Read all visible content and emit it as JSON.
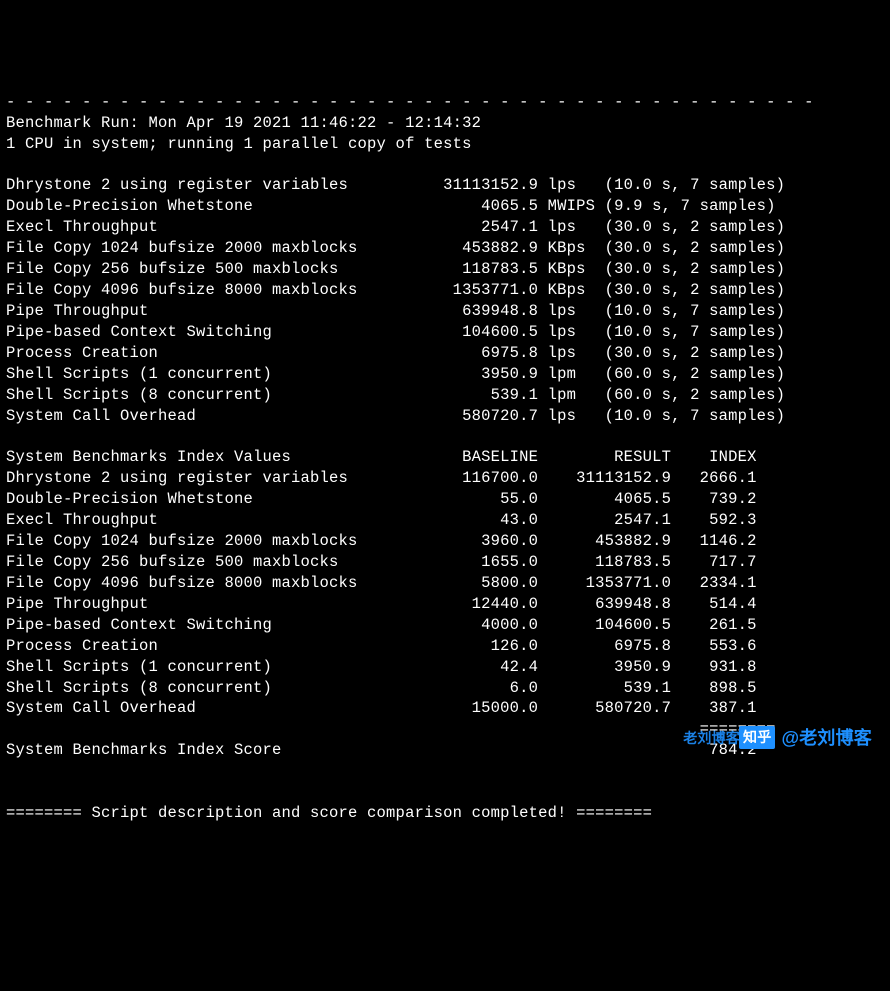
{
  "divider": "- - - - - - - - - - - - - - - - - - - - - - - - - - - - - - - - - - - - - - - - - - -",
  "header": {
    "run_line": "Benchmark Run: Mon Apr 19 2021 11:46:22 - 12:14:32",
    "cpu_line": "1 CPU in system; running 1 parallel copy of tests"
  },
  "results": [
    {
      "name": "Dhrystone 2 using register variables",
      "value": "31113152.9",
      "unit": "lps",
      "note": "(10.0 s, 7 samples)"
    },
    {
      "name": "Double-Precision Whetstone",
      "value": "4065.5",
      "unit": "MWIPS",
      "note": "(9.9 s, 7 samples)"
    },
    {
      "name": "Execl Throughput",
      "value": "2547.1",
      "unit": "lps",
      "note": "(30.0 s, 2 samples)"
    },
    {
      "name": "File Copy 1024 bufsize 2000 maxblocks",
      "value": "453882.9",
      "unit": "KBps",
      "note": "(30.0 s, 2 samples)"
    },
    {
      "name": "File Copy 256 bufsize 500 maxblocks",
      "value": "118783.5",
      "unit": "KBps",
      "note": "(30.0 s, 2 samples)"
    },
    {
      "name": "File Copy 4096 bufsize 8000 maxblocks",
      "value": "1353771.0",
      "unit": "KBps",
      "note": "(30.0 s, 2 samples)"
    },
    {
      "name": "Pipe Throughput",
      "value": "639948.8",
      "unit": "lps",
      "note": "(10.0 s, 7 samples)"
    },
    {
      "name": "Pipe-based Context Switching",
      "value": "104600.5",
      "unit": "lps",
      "note": "(10.0 s, 7 samples)"
    },
    {
      "name": "Process Creation",
      "value": "6975.8",
      "unit": "lps",
      "note": "(30.0 s, 2 samples)"
    },
    {
      "name": "Shell Scripts (1 concurrent)",
      "value": "3950.9",
      "unit": "lpm",
      "note": "(60.0 s, 2 samples)"
    },
    {
      "name": "Shell Scripts (8 concurrent)",
      "value": "539.1",
      "unit": "lpm",
      "note": "(60.0 s, 2 samples)"
    },
    {
      "name": "System Call Overhead",
      "value": "580720.7",
      "unit": "lps",
      "note": "(10.0 s, 7 samples)"
    }
  ],
  "index_header": {
    "title": "System Benchmarks Index Values",
    "col1": "BASELINE",
    "col2": "RESULT",
    "col3": "INDEX"
  },
  "index_rows": [
    {
      "name": "Dhrystone 2 using register variables",
      "baseline": "116700.0",
      "result": "31113152.9",
      "index": "2666.1"
    },
    {
      "name": "Double-Precision Whetstone",
      "baseline": "55.0",
      "result": "4065.5",
      "index": "739.2"
    },
    {
      "name": "Execl Throughput",
      "baseline": "43.0",
      "result": "2547.1",
      "index": "592.3"
    },
    {
      "name": "File Copy 1024 bufsize 2000 maxblocks",
      "baseline": "3960.0",
      "result": "453882.9",
      "index": "1146.2"
    },
    {
      "name": "File Copy 256 bufsize 500 maxblocks",
      "baseline": "1655.0",
      "result": "118783.5",
      "index": "717.7"
    },
    {
      "name": "File Copy 4096 bufsize 8000 maxblocks",
      "baseline": "5800.0",
      "result": "1353771.0",
      "index": "2334.1"
    },
    {
      "name": "Pipe Throughput",
      "baseline": "12440.0",
      "result": "639948.8",
      "index": "514.4"
    },
    {
      "name": "Pipe-based Context Switching",
      "baseline": "4000.0",
      "result": "104600.5",
      "index": "261.5"
    },
    {
      "name": "Process Creation",
      "baseline": "126.0",
      "result": "6975.8",
      "index": "553.6"
    },
    {
      "name": "Shell Scripts (1 concurrent)",
      "baseline": "42.4",
      "result": "3950.9",
      "index": "931.8"
    },
    {
      "name": "Shell Scripts (8 concurrent)",
      "baseline": "6.0",
      "result": "539.1",
      "index": "898.5"
    },
    {
      "name": "System Call Overhead",
      "baseline": "15000.0",
      "result": "580720.7",
      "index": "387.1"
    }
  ],
  "score_divider": "                                                                         ========",
  "score_line": {
    "label": "System Benchmarks Index Score",
    "value": "784.2"
  },
  "footer": "======== Script description and score comparison completed! ========",
  "watermark": {
    "prefix": "老刘博客",
    "logo": "知乎",
    "text": "@老刘博客"
  }
}
